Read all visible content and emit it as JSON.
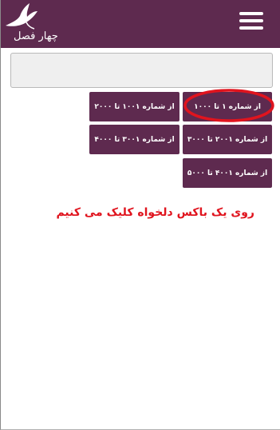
{
  "header": {
    "logo_text": "چهار فصل",
    "logo_icon": "bird-logo-icon",
    "menu_icon": "hamburger-menu-icon",
    "background_color": "#5e2a4f"
  },
  "search": {
    "value": ""
  },
  "ranges": {
    "items": [
      {
        "label": "از شماره ۱ تا ۱۰۰۰",
        "highlighted": true
      },
      {
        "label": "از شماره ۱۰۰۱ تا ۲۰۰۰"
      },
      {
        "label": "از شماره ۲۰۰۱ تا ۳۰۰۰"
      },
      {
        "label": "از شماره ۳۰۰۱ تا ۴۰۰۰"
      },
      {
        "label": "از شماره ۴۰۰۱ تا ۵۰۰۰"
      }
    ],
    "button_color": "#5e2a4f",
    "highlight_color": "#e0141e"
  },
  "instruction": {
    "text": "روی یک باکس دلخواه کلیک می کنیم",
    "color": "#e0141e"
  }
}
